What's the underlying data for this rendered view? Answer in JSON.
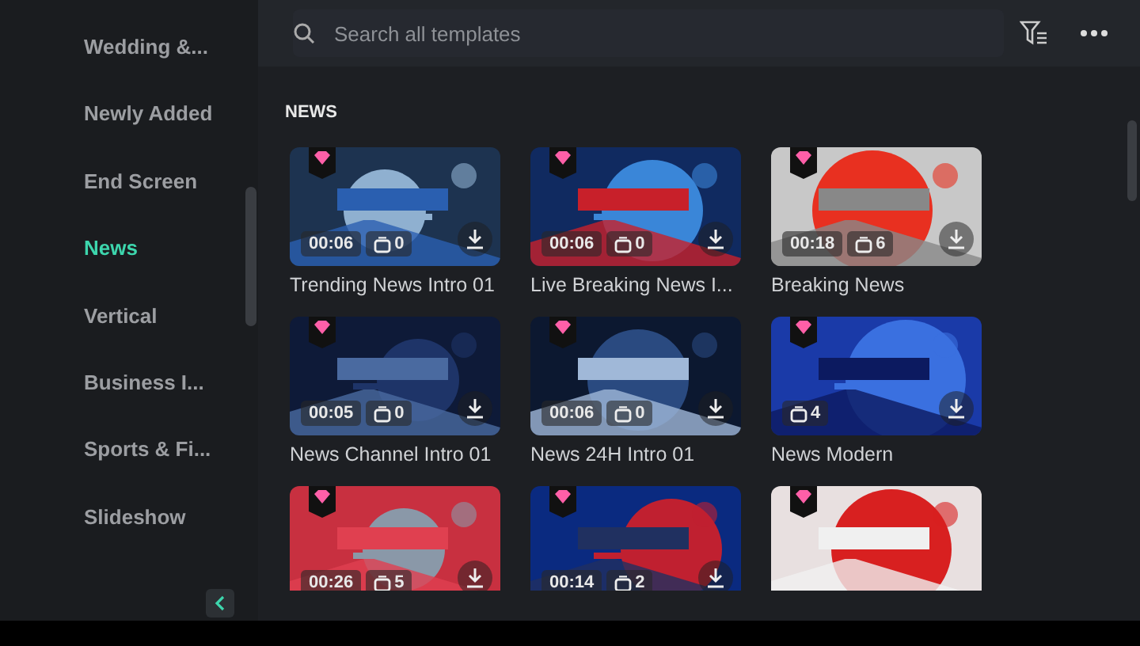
{
  "sidebar": {
    "items": [
      {
        "label": "Wedding &...",
        "selected": false
      },
      {
        "label": "Newly Added",
        "selected": false
      },
      {
        "label": "End Screen",
        "selected": false
      },
      {
        "label": "News",
        "selected": true
      },
      {
        "label": "Vertical",
        "selected": false
      },
      {
        "label": "Business I...",
        "selected": false
      },
      {
        "label": "Sports & Fi...",
        "selected": false
      },
      {
        "label": "Slideshow",
        "selected": false
      }
    ]
  },
  "search": {
    "placeholder": "Search all templates"
  },
  "section": {
    "title": "NEWS"
  },
  "templates": [
    {
      "title": "Trending News Intro 01",
      "duration": "00:06",
      "scenes": "0"
    },
    {
      "title": "Live Breaking News I...",
      "duration": "00:06",
      "scenes": "0"
    },
    {
      "title": "Breaking News",
      "duration": "00:18",
      "scenes": "6"
    },
    {
      "title": "News Channel Intro 01",
      "duration": "00:05",
      "scenes": "0"
    },
    {
      "title": "News 24H Intro 01",
      "duration": "00:06",
      "scenes": "0"
    },
    {
      "title": "News Modern",
      "scenes": "4"
    },
    {
      "duration": "00:26",
      "scenes": "5"
    },
    {
      "duration": "00:14",
      "scenes": "2"
    },
    {
      "kind": "picture"
    }
  ]
}
